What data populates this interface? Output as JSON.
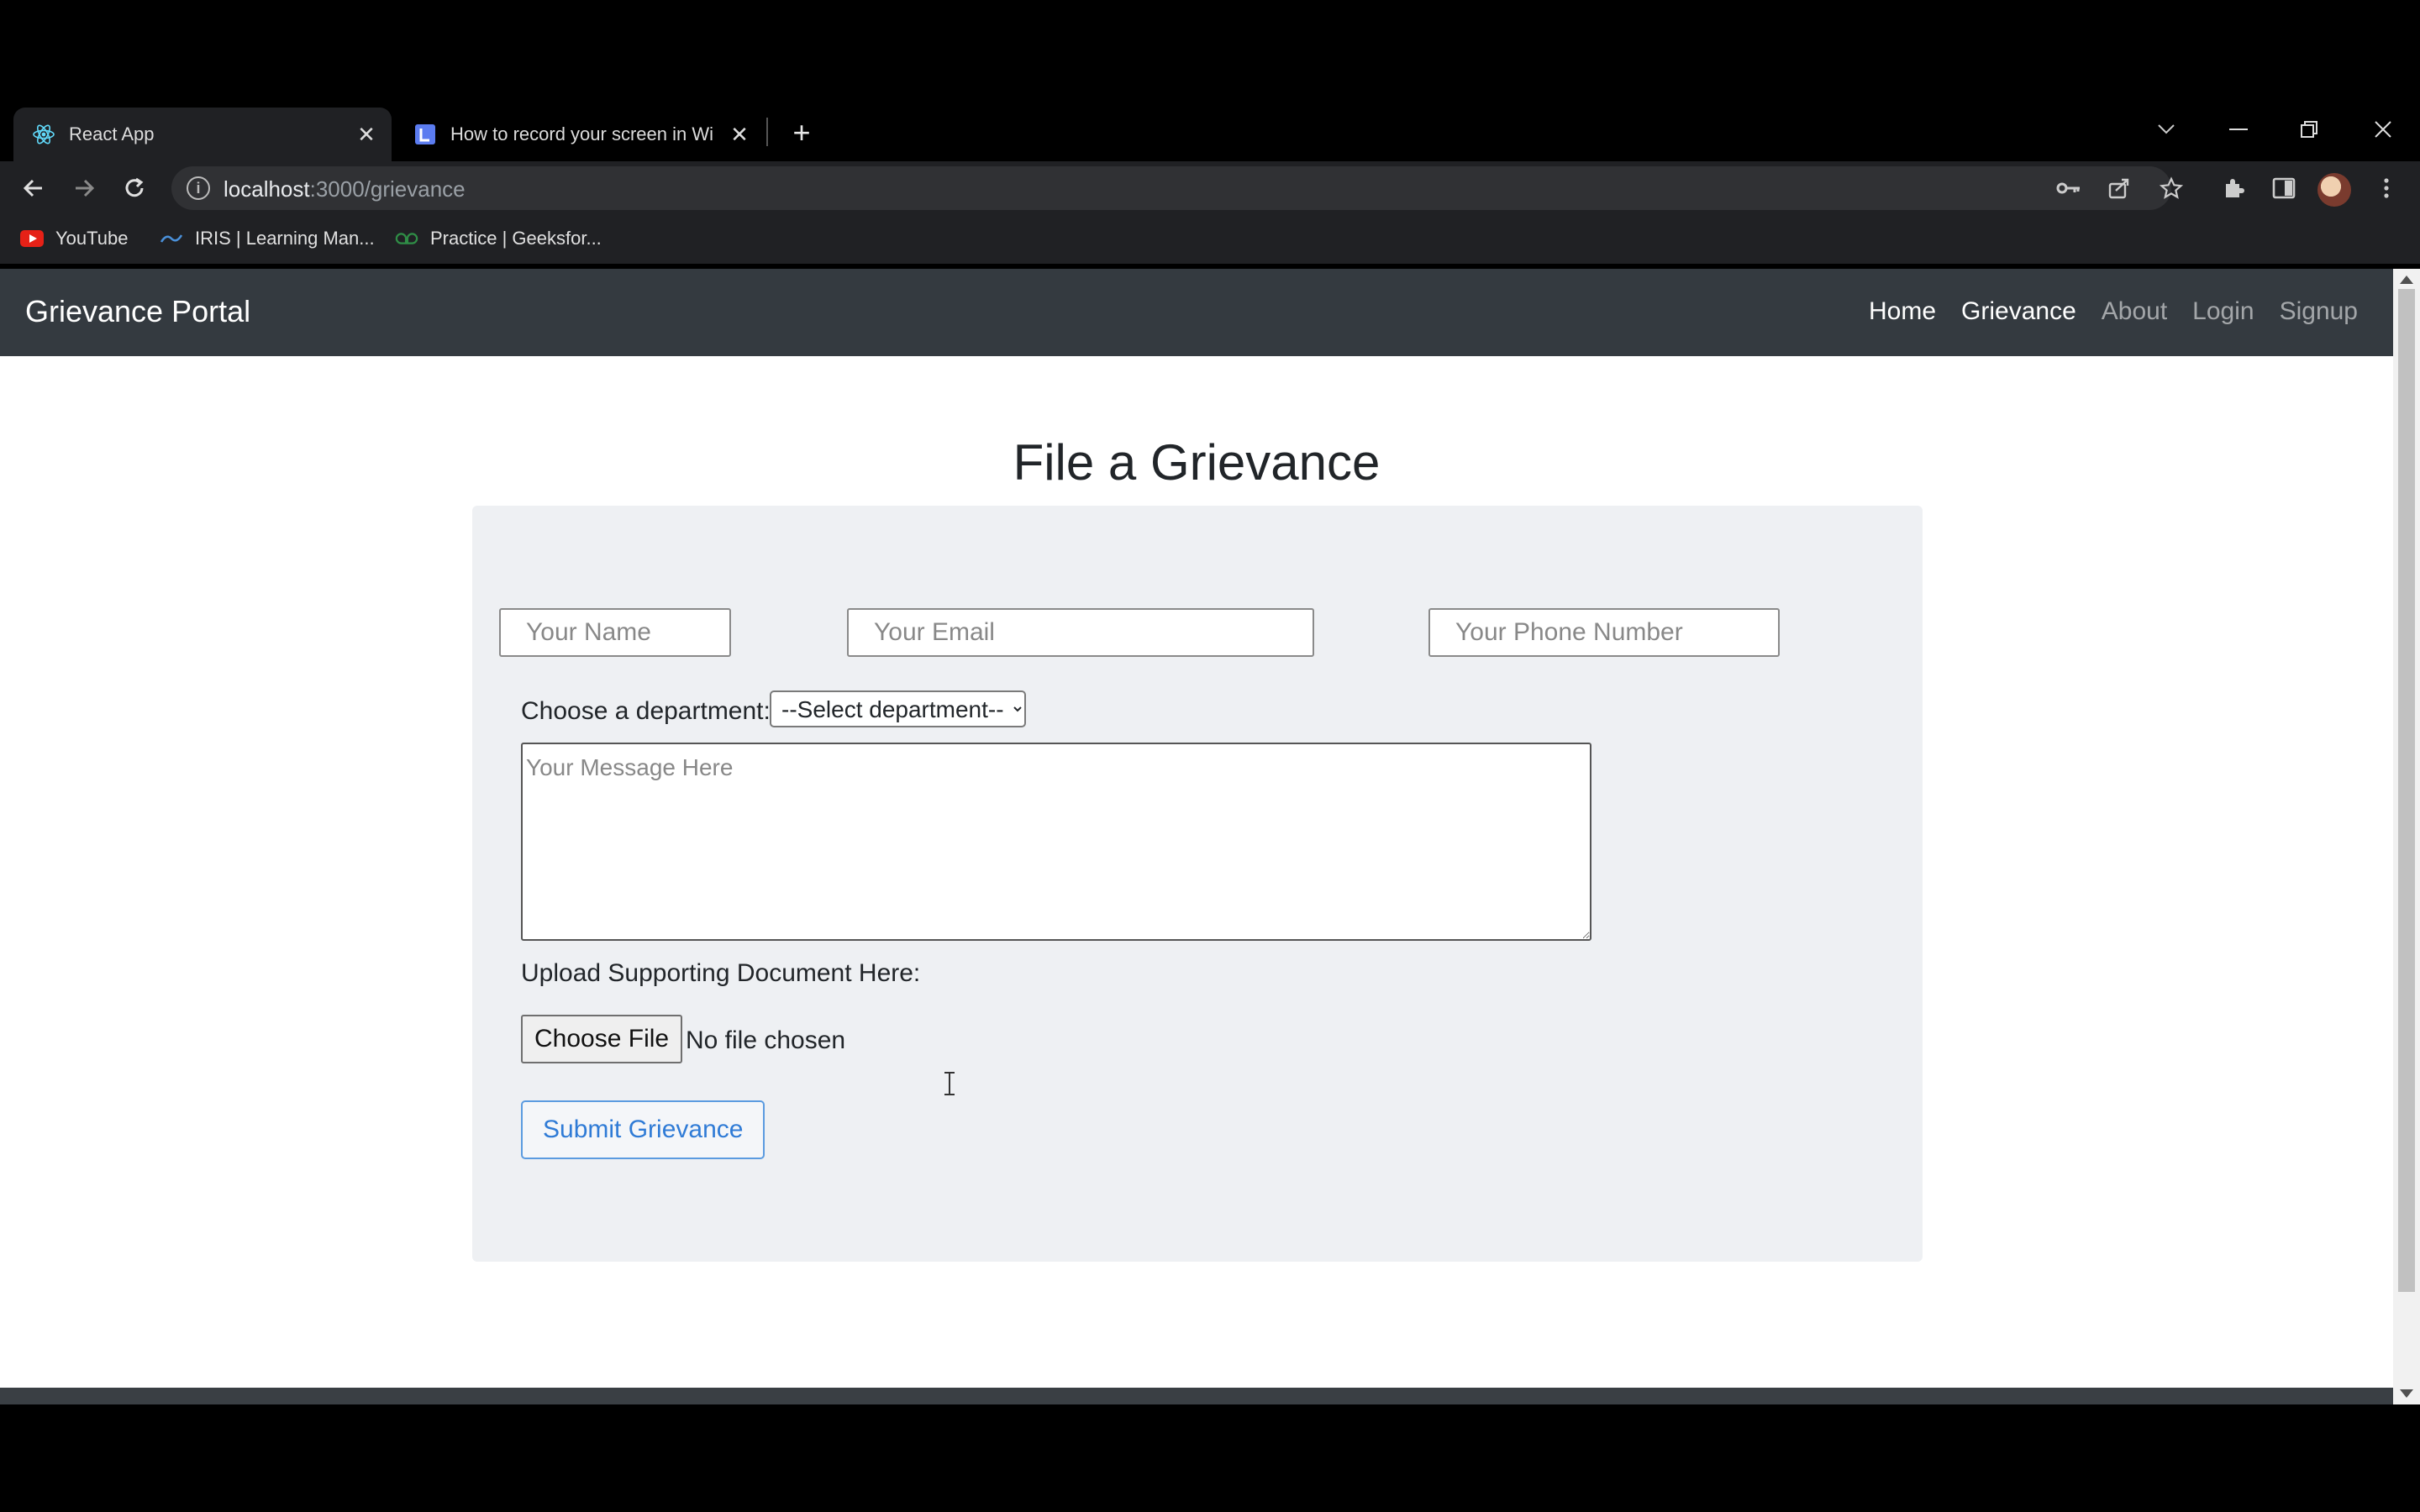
{
  "browser": {
    "tabs": [
      {
        "title": "React App",
        "active": true,
        "icon": "react-icon"
      },
      {
        "title": "How to record your screen in Wi",
        "active": false,
        "icon": "loom-icon"
      }
    ],
    "new_tab_glyph": "+",
    "address": {
      "host": "localhost",
      "path": ":3000/grievance"
    },
    "bookmarks": [
      {
        "label": "YouTube",
        "icon": "youtube-icon"
      },
      {
        "label": "IRIS | Learning Man...",
        "icon": "iris-icon"
      },
      {
        "label": "Practice | Geeksfor...",
        "icon": "gfg-icon"
      }
    ]
  },
  "app": {
    "brand": "Grievance Portal",
    "nav": [
      {
        "label": "Home",
        "active": true
      },
      {
        "label": "Grievance",
        "active": true
      },
      {
        "label": "About",
        "active": false
      },
      {
        "label": "Login",
        "active": false
      },
      {
        "label": "Signup",
        "active": false
      }
    ]
  },
  "form": {
    "heading": "File a Grievance",
    "name_placeholder": "Your Name",
    "email_placeholder": "Your Email",
    "phone_placeholder": "Your Phone Number",
    "department_label": "Choose a department:",
    "department_selected": "--Select department--",
    "message_placeholder": "Your Message Here",
    "upload_label": "Upload Supporting Document Here:",
    "choose_file_label": "Choose File",
    "file_status": "No file chosen",
    "submit_label": "Submit Grievance"
  },
  "colors": {
    "navbar": "#343a40",
    "card": "#eef0f3",
    "submit_accent": "#2f7bd6"
  }
}
